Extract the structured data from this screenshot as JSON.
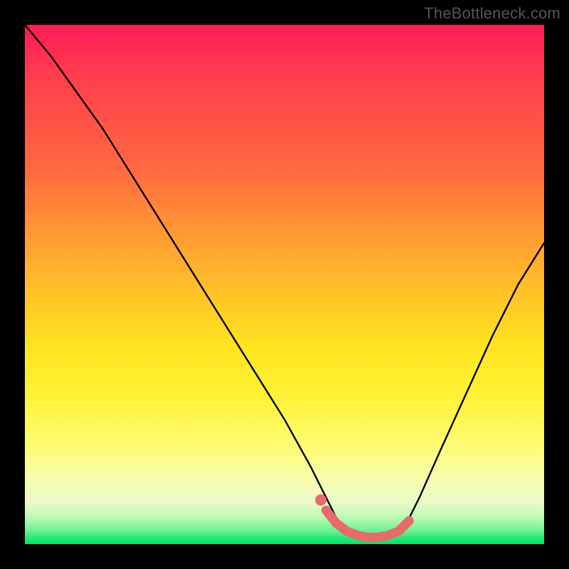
{
  "watermark": "TheBottleneck.com",
  "colors": {
    "frame": "#000000",
    "curve": "#000000",
    "marker_fill": "#e86a6a",
    "marker_stroke": "#d85a5a"
  },
  "chart_data": {
    "type": "line",
    "title": "",
    "xlabel": "",
    "ylabel": "",
    "xlim": [
      0,
      100
    ],
    "ylim": [
      0,
      100
    ],
    "series": [
      {
        "name": "bottleneck-curve",
        "x": [
          0,
          5,
          10,
          15,
          20,
          25,
          30,
          35,
          40,
          45,
          50,
          55,
          58,
          60,
          62,
          64,
          66,
          68,
          70,
          72,
          74,
          76,
          80,
          85,
          90,
          95,
          100
        ],
        "y": [
          100,
          94,
          87,
          80,
          72,
          64,
          56,
          48,
          40,
          32,
          24,
          15,
          9,
          5,
          2.5,
          1.2,
          0.6,
          0.6,
          1.2,
          2.5,
          5,
          9,
          18,
          29,
          40,
          50,
          58
        ]
      }
    ],
    "markers": {
      "name": "highlight-segment",
      "x": [
        58,
        60,
        62,
        64,
        66,
        68,
        70,
        72,
        74
      ],
      "y": [
        6.5,
        4.0,
        2.5,
        1.7,
        1.3,
        1.3,
        1.7,
        2.5,
        4.5
      ],
      "dot": {
        "x": 57,
        "y": 8.5
      }
    },
    "background_gradient": {
      "top": "#ff1a55",
      "mid_upper": "#ff9933",
      "mid": "#ffe41f",
      "mid_lower": "#fdfd7a",
      "bottom": "#00e667"
    }
  }
}
